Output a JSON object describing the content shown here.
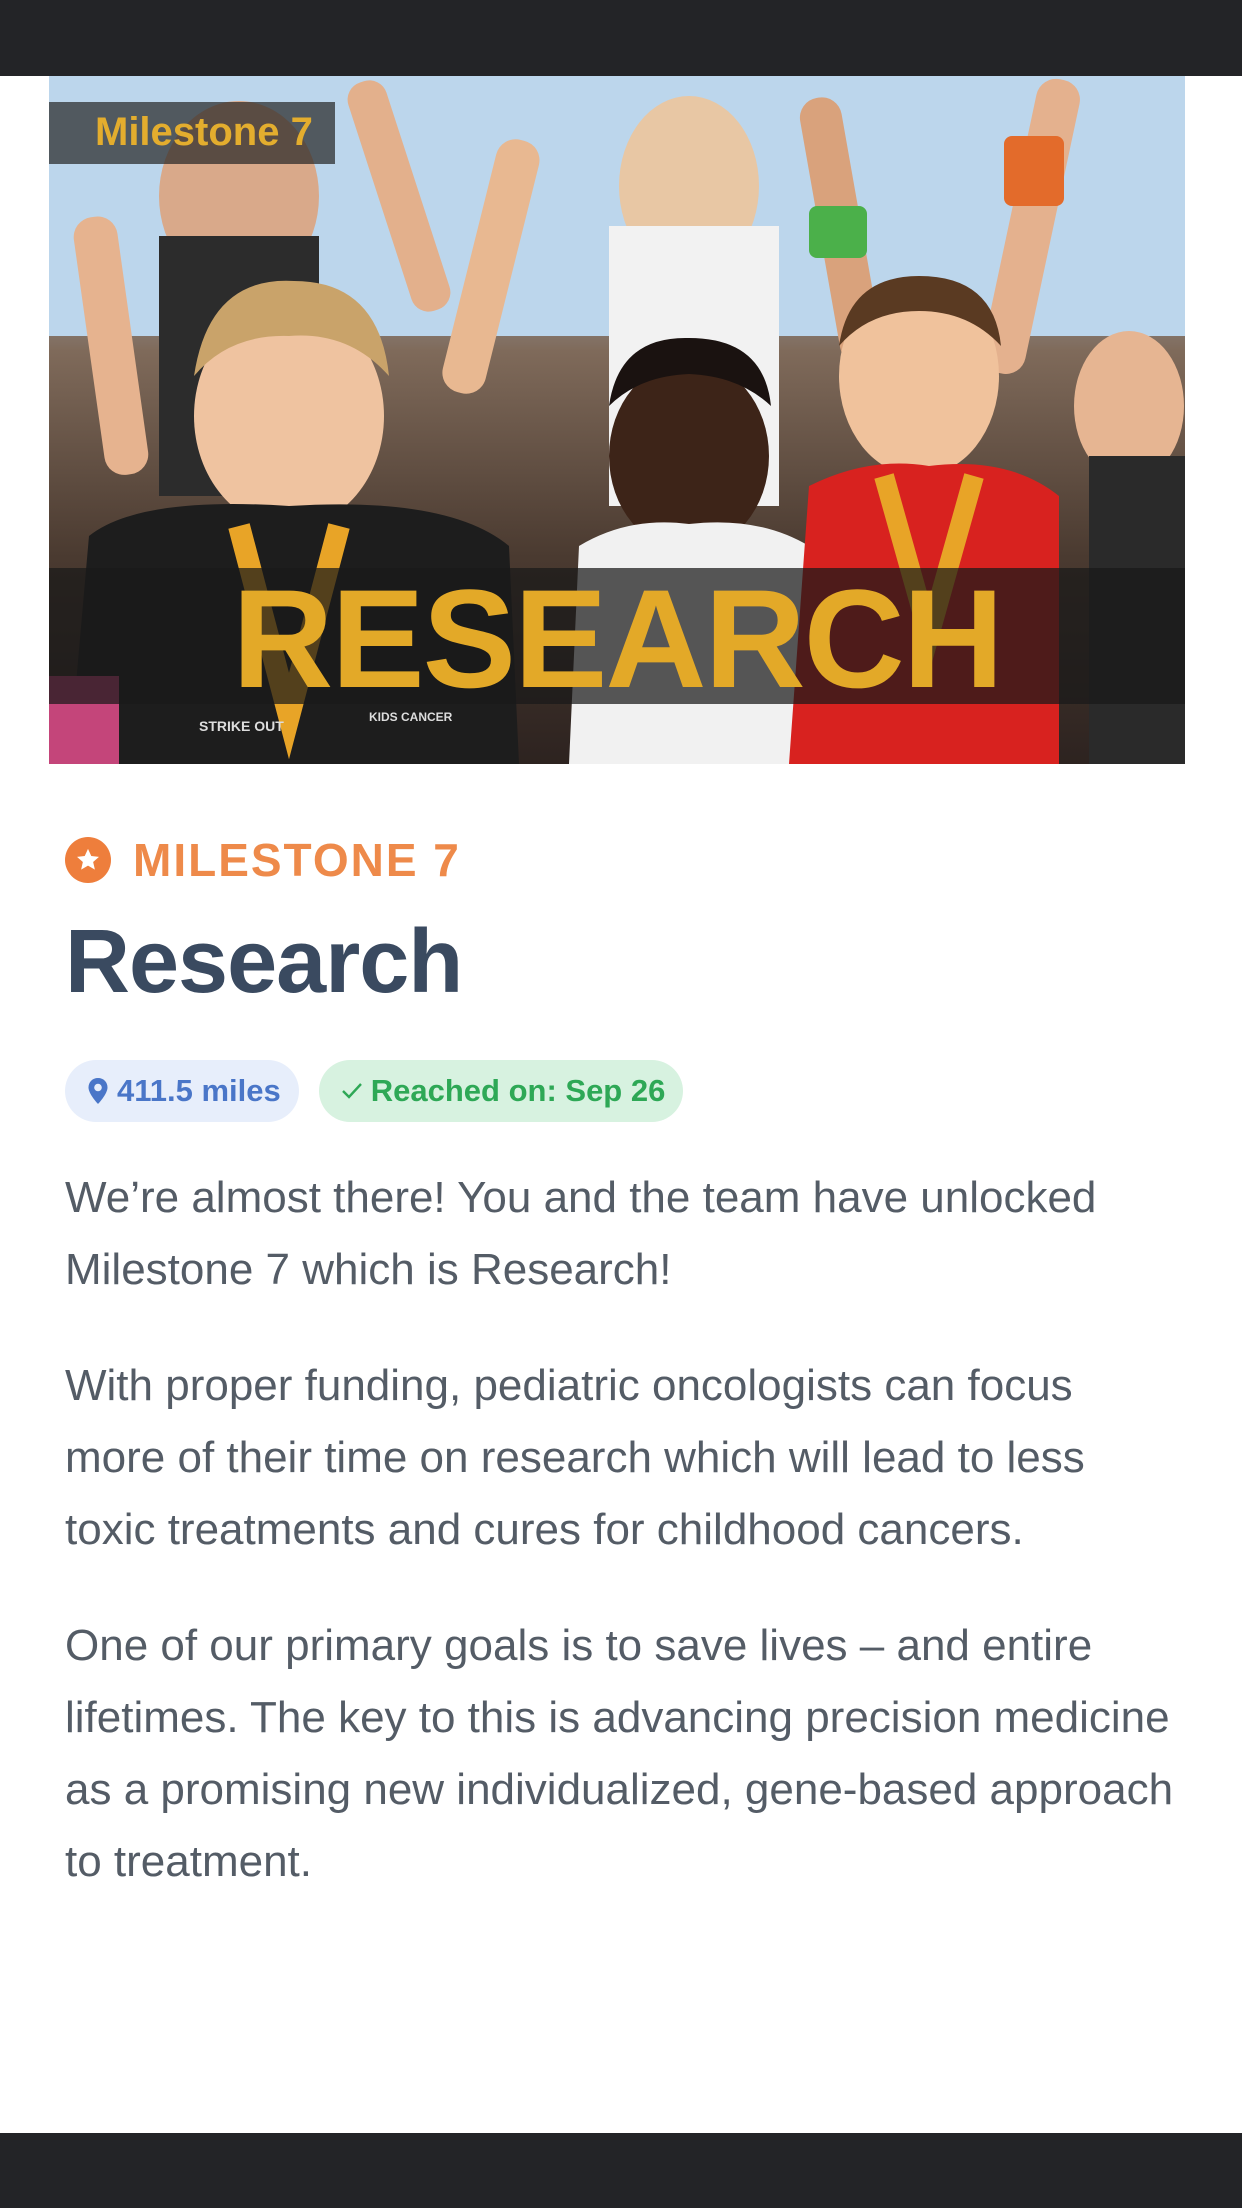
{
  "hero": {
    "tag": "Milestone 7",
    "word": "RESEARCH",
    "shirt_text_1": "STRIKE OUT",
    "shirt_text_2": "KIDS CANCER"
  },
  "milestone": {
    "eyebrow": "MILESTONE 7",
    "title": "Research",
    "distance": "411.5 miles",
    "reached": "Reached on: Sep 26"
  },
  "body": {
    "p1": "We’re almost there! You and the team have unlocked Milestone 7 which is Research!",
    "p2": "With proper funding, pediatric oncologists can focus more of their time on research which will lead to less toxic treatments and cures for childhood cancers.",
    "p3": "One of our primary goals is to save lives – and entire lifetimes. The key to this is advancing precision medicine as a promising new individualized, gene-based approach to treatment."
  },
  "colors": {
    "accent_orange": "#ee7e3c",
    "gold": "#e3a928",
    "title": "#3a4a60",
    "blue_badge": "#4a76c8",
    "green_badge": "#2ea856"
  },
  "icons": [
    "star-icon",
    "map-pin-icon",
    "check-icon"
  ]
}
